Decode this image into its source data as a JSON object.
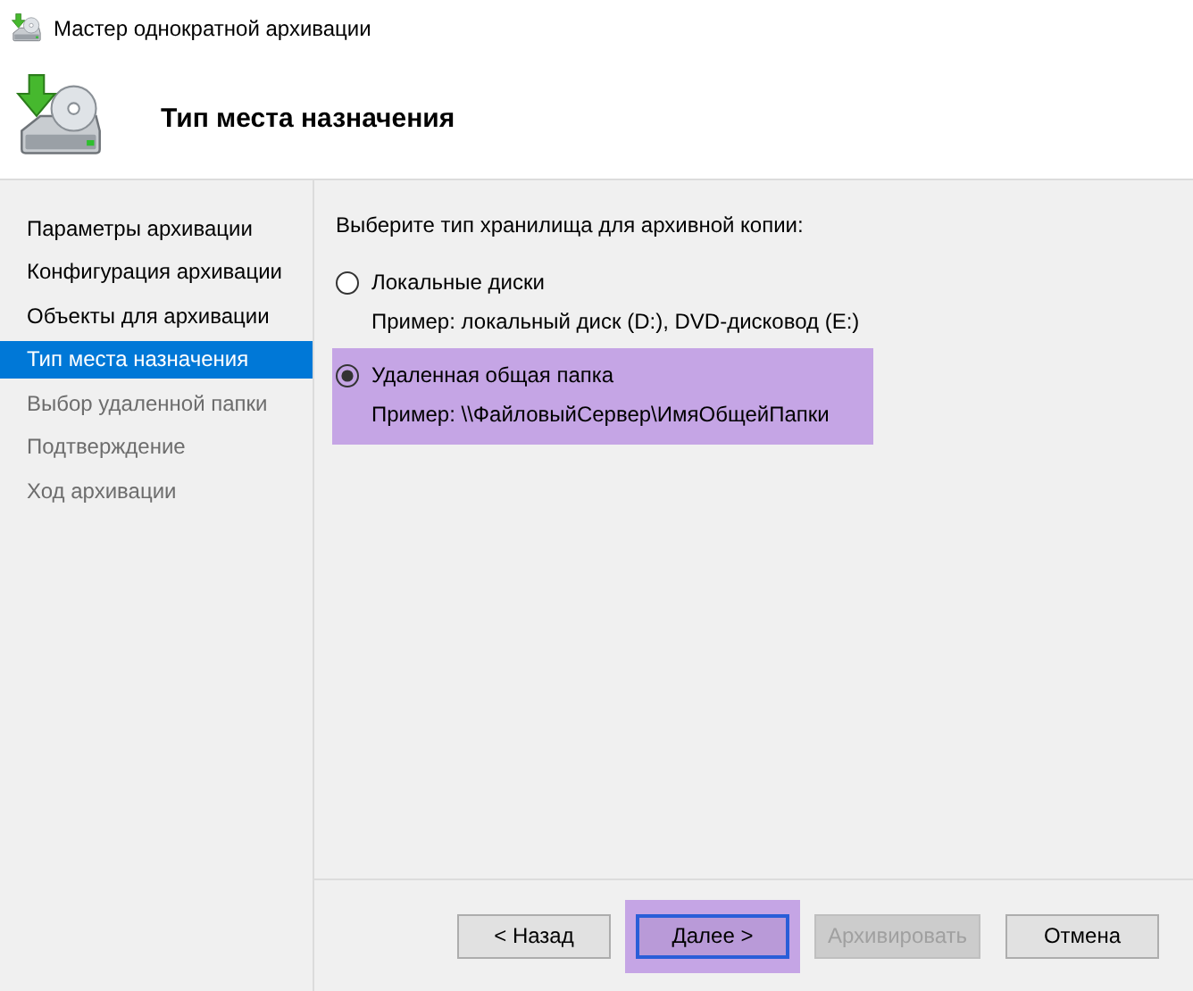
{
  "window": {
    "title": "Мастер однократной архивации"
  },
  "header": {
    "title": "Тип места назначения"
  },
  "steps": [
    {
      "label": "Параметры архивации",
      "selected": false,
      "disabled": false
    },
    {
      "label": "Конфигурация архивации",
      "selected": false,
      "disabled": false
    },
    {
      "label": "Объекты для архивации",
      "selected": false,
      "disabled": false
    },
    {
      "label": "Тип места назначения",
      "selected": true,
      "disabled": false
    },
    {
      "label": "Выбор удаленной папки",
      "selected": false,
      "disabled": true
    },
    {
      "label": "Подтверждение",
      "selected": false,
      "disabled": true
    },
    {
      "label": "Ход архивации",
      "selected": false,
      "disabled": true
    }
  ],
  "prompt": "Выберите тип хранилища для архивной копии:",
  "options": [
    {
      "label": "Локальные диски",
      "example": "Пример: локальный диск (D:), DVD-дисковод (E:)",
      "selected": false,
      "highlighted": false
    },
    {
      "label": "Удаленная общая папка",
      "example": "Пример: \\\\ФайловыйСервер\\ИмяОбщейПапки",
      "selected": true,
      "highlighted": true
    }
  ],
  "buttons": [
    {
      "label": "< Назад",
      "disabled": false,
      "focused": false,
      "highlighted": false
    },
    {
      "label": "Далее >",
      "disabled": false,
      "focused": true,
      "highlighted": true
    },
    {
      "label": "Архивировать",
      "disabled": true,
      "focused": false,
      "highlighted": false
    },
    {
      "label": "Отмена",
      "disabled": false,
      "focused": false,
      "highlighted": false
    }
  ]
}
